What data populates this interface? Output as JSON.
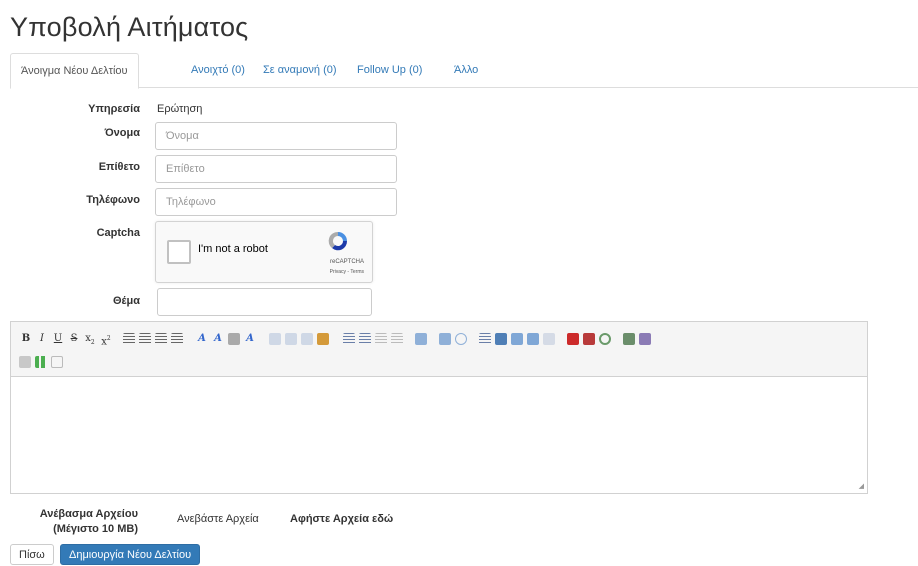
{
  "page": {
    "title": "Υποβολή Αιτήματος"
  },
  "tabs": [
    {
      "label": "Άνοιγμα Νέου Δελτίου",
      "active": true
    },
    {
      "label": "Ανοιχτό (0)"
    },
    {
      "label": "Σε αναμονή (0)"
    },
    {
      "label": "Follow Up (0)"
    },
    {
      "label": "Άλλο"
    }
  ],
  "form": {
    "service_label": "Υπηρεσία",
    "service_value": "Ερώτηση",
    "name_label": "Όνομα",
    "name_placeholder": "Όνομα",
    "surname_label": "Επίθετο",
    "surname_placeholder": "Επίθετο",
    "phone_label": "Τηλέφωνο",
    "phone_placeholder": "Τηλέφωνο",
    "captcha_label": "Captcha",
    "subject_label": "Θέμα",
    "subject_value": ""
  },
  "captcha": {
    "checkbox_text": "I'm not a robot",
    "brand": "reCAPTCHA",
    "links": "Privacy - Terms"
  },
  "upload": {
    "label_line1": "Ανέβασμα Αρχείου",
    "label_line2": "(Μέγιστο 10 MB)",
    "upload_link": "Ανεβάστε Αρχεία",
    "drop_text": "Αφήστε Αρχεία εδώ"
  },
  "buttons": {
    "back": "Πίσω",
    "create": "Δημιουργία Νέου Δελτίου"
  },
  "colors": {
    "link": "#337ab7",
    "primary": "#337ab7"
  }
}
